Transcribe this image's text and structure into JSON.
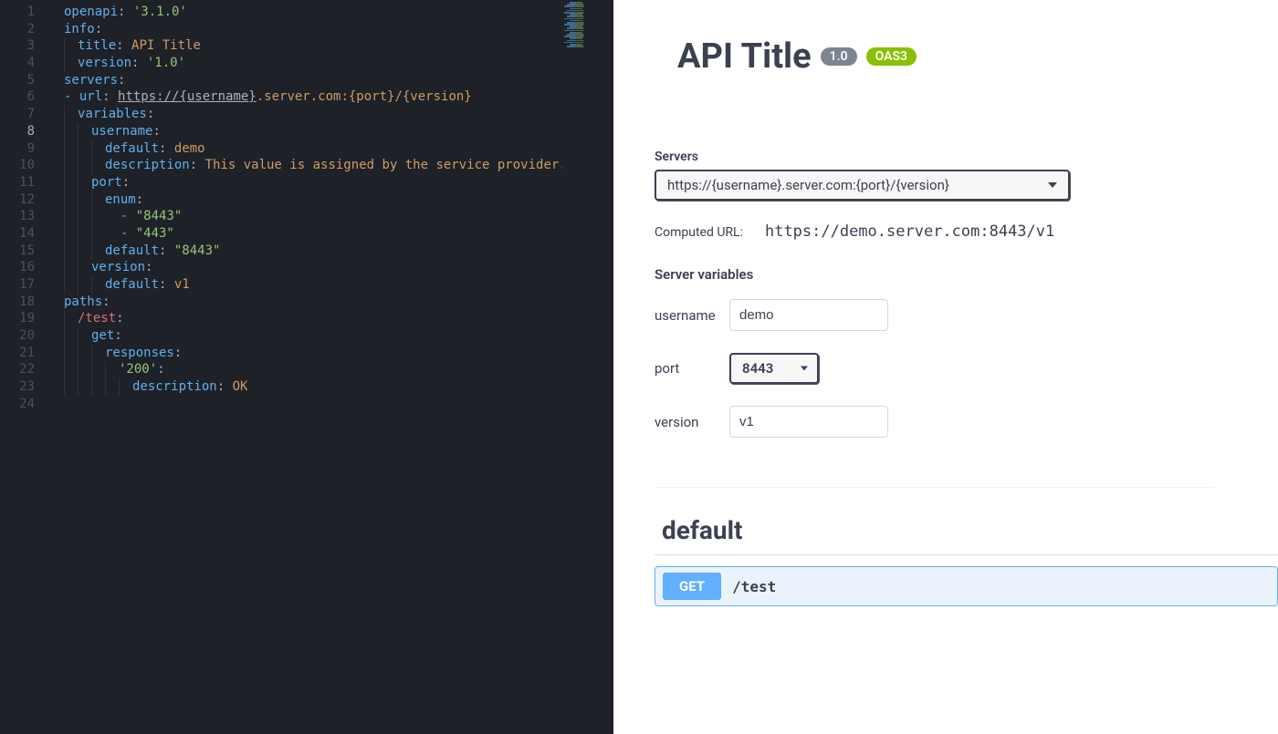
{
  "editor": {
    "cursor_line": 8,
    "lines": [
      {
        "n": 1,
        "tokens": [
          [
            "key",
            "openapi"
          ],
          [
            "pun",
            ": "
          ],
          [
            "str",
            "'3.1.0'"
          ]
        ]
      },
      {
        "n": 2,
        "tokens": [
          [
            "key",
            "info"
          ],
          [
            "pun",
            ":"
          ]
        ]
      },
      {
        "n": 3,
        "tokens": [
          [
            "ind",
            ""
          ],
          [
            "key",
            "title"
          ],
          [
            "pun",
            ": "
          ],
          [
            "val",
            "API Title"
          ]
        ]
      },
      {
        "n": 4,
        "tokens": [
          [
            "ind",
            ""
          ],
          [
            "key",
            "version"
          ],
          [
            "pun",
            ": "
          ],
          [
            "str",
            "'1.0'"
          ]
        ]
      },
      {
        "n": 5,
        "tokens": [
          [
            "key",
            "servers"
          ],
          [
            "pun",
            ":"
          ]
        ]
      },
      {
        "n": 6,
        "tokens": [
          [
            "dash",
            "- "
          ],
          [
            "key",
            "url"
          ],
          [
            "pun",
            ": "
          ],
          [
            "url",
            "https://{username}"
          ],
          [
            "val",
            ".server.com:{port}/{version}"
          ]
        ]
      },
      {
        "n": 7,
        "tokens": [
          [
            "ind",
            ""
          ],
          [
            "key",
            "variables"
          ],
          [
            "pun",
            ":"
          ]
        ]
      },
      {
        "n": 8,
        "tokens": [
          [
            "ind",
            ""
          ],
          [
            "ind",
            ""
          ],
          [
            "key",
            "username"
          ],
          [
            "pun",
            ":"
          ]
        ],
        "hl": true
      },
      {
        "n": 9,
        "tokens": [
          [
            "ind",
            ""
          ],
          [
            "ind",
            ""
          ],
          [
            "ind",
            ""
          ],
          [
            "key",
            "default"
          ],
          [
            "pun",
            ": "
          ],
          [
            "val",
            "demo"
          ]
        ]
      },
      {
        "n": 10,
        "tokens": [
          [
            "ind",
            ""
          ],
          [
            "ind",
            ""
          ],
          [
            "ind",
            ""
          ],
          [
            "key",
            "description"
          ],
          [
            "pun",
            ": "
          ],
          [
            "val",
            "This value is assigned by the service provider."
          ]
        ]
      },
      {
        "n": 11,
        "tokens": [
          [
            "ind",
            ""
          ],
          [
            "ind",
            ""
          ],
          [
            "key",
            "port"
          ],
          [
            "pun",
            ":"
          ]
        ]
      },
      {
        "n": 12,
        "tokens": [
          [
            "ind",
            ""
          ],
          [
            "ind",
            ""
          ],
          [
            "ind",
            ""
          ],
          [
            "key",
            "enum"
          ],
          [
            "pun",
            ":"
          ]
        ]
      },
      {
        "n": 13,
        "tokens": [
          [
            "ind",
            ""
          ],
          [
            "ind",
            ""
          ],
          [
            "ind",
            ""
          ],
          [
            "dash",
            "  - "
          ],
          [
            "str",
            "\"8443\""
          ]
        ]
      },
      {
        "n": 14,
        "tokens": [
          [
            "ind",
            ""
          ],
          [
            "ind",
            ""
          ],
          [
            "ind",
            ""
          ],
          [
            "dash",
            "  - "
          ],
          [
            "str",
            "\"443\""
          ]
        ]
      },
      {
        "n": 15,
        "tokens": [
          [
            "ind",
            ""
          ],
          [
            "ind",
            ""
          ],
          [
            "ind",
            ""
          ],
          [
            "key",
            "default"
          ],
          [
            "pun",
            ": "
          ],
          [
            "str",
            "\"8443\""
          ]
        ]
      },
      {
        "n": 16,
        "tokens": [
          [
            "ind",
            ""
          ],
          [
            "ind",
            ""
          ],
          [
            "key",
            "version"
          ],
          [
            "pun",
            ":"
          ]
        ]
      },
      {
        "n": 17,
        "tokens": [
          [
            "ind",
            ""
          ],
          [
            "ind",
            ""
          ],
          [
            "ind",
            ""
          ],
          [
            "key",
            "default"
          ],
          [
            "pun",
            ": "
          ],
          [
            "val",
            "v1"
          ]
        ]
      },
      {
        "n": 18,
        "tokens": [
          [
            "key",
            "paths"
          ],
          [
            "pun",
            ":"
          ]
        ]
      },
      {
        "n": 19,
        "tokens": [
          [
            "ind",
            ""
          ],
          [
            "kw",
            "/test"
          ],
          [
            "pun",
            ":"
          ]
        ]
      },
      {
        "n": 20,
        "tokens": [
          [
            "ind",
            ""
          ],
          [
            "ind",
            ""
          ],
          [
            "key",
            "get"
          ],
          [
            "pun",
            ":"
          ]
        ]
      },
      {
        "n": 21,
        "tokens": [
          [
            "ind",
            ""
          ],
          [
            "ind",
            ""
          ],
          [
            "ind",
            ""
          ],
          [
            "key",
            "responses"
          ],
          [
            "pun",
            ":"
          ]
        ]
      },
      {
        "n": 22,
        "tokens": [
          [
            "ind",
            ""
          ],
          [
            "ind",
            ""
          ],
          [
            "ind",
            ""
          ],
          [
            "ind",
            ""
          ],
          [
            "str",
            "'200'"
          ],
          [
            "pun",
            ":"
          ]
        ]
      },
      {
        "n": 23,
        "tokens": [
          [
            "ind",
            ""
          ],
          [
            "ind",
            ""
          ],
          [
            "ind",
            ""
          ],
          [
            "ind",
            ""
          ],
          [
            "ind",
            ""
          ],
          [
            "key",
            "description"
          ],
          [
            "pun",
            ": "
          ],
          [
            "val",
            "OK"
          ]
        ]
      },
      {
        "n": 24,
        "tokens": []
      }
    ]
  },
  "preview": {
    "title": "API Title",
    "version": "1.0",
    "oas_badge": "OAS3",
    "servers_label": "Servers",
    "server_url": "https://{username}.server.com:{port}/{version}",
    "computed_label": "Computed URL:",
    "computed_url": "https://demo.server.com:8443/v1",
    "server_variables_label": "Server variables",
    "vars": {
      "username": {
        "label": "username",
        "value": "demo"
      },
      "port": {
        "label": "port",
        "value": "8443"
      },
      "version": {
        "label": "version",
        "value": "v1"
      }
    },
    "tag": "default",
    "op": {
      "method": "GET",
      "path": "/test"
    }
  }
}
